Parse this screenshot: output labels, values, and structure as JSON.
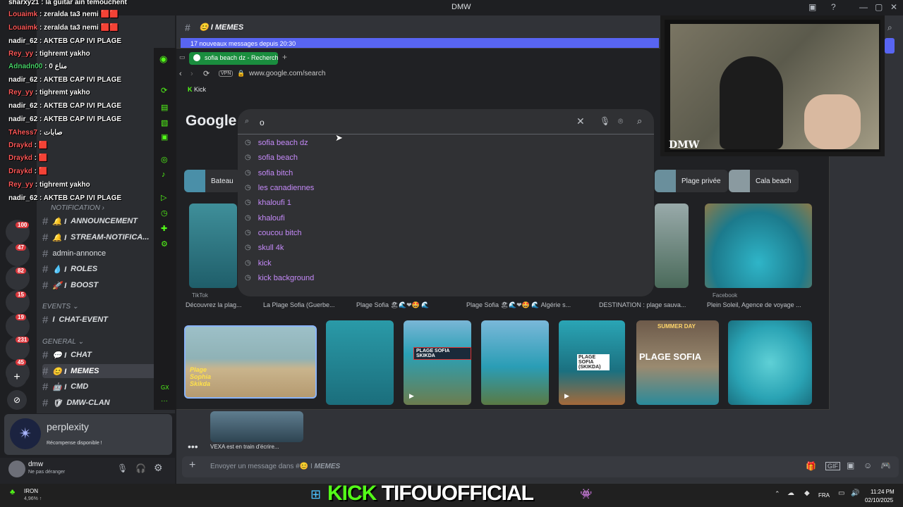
{
  "window": {
    "title": "DMW"
  },
  "overlay_chat": [
    {
      "user": "sharxy21",
      "msg": "la guitar ain temouchent"
    },
    {
      "user": "Louaimk",
      "msg": "zeralda ta3 nemi"
    },
    {
      "user": "Louaimk",
      "msg": "zeralda ta3 nemi"
    },
    {
      "user": "nadir_62",
      "msg": "AKTEB CAP IVI PLAGE"
    },
    {
      "user": "Rey_yy",
      "msg": "tighremt yakho"
    },
    {
      "user": "Adnadn00",
      "msg": "0 مناع"
    },
    {
      "user": "nadir_62",
      "msg": "AKTEB CAP IVI PLAGE"
    },
    {
      "user": "Rey_yy",
      "msg": "tighremt yakho"
    },
    {
      "user": "nadir_62",
      "msg": "AKTEB CAP IVI PLAGE"
    },
    {
      "user": "nadir_62",
      "msg": "AKTEB CAP IVI PLAGE"
    },
    {
      "user": "TAhess7",
      "msg": "صابات"
    },
    {
      "user": "Draykd",
      "msg": ""
    },
    {
      "user": "Draykd",
      "msg": ""
    },
    {
      "user": "Draykd",
      "msg": ""
    },
    {
      "user": "Rey_yy",
      "msg": "tighremt yakho"
    },
    {
      "user": "nadir_62",
      "msg": "AKTEB CAP IVI PLAGE"
    }
  ],
  "channels": {
    "categories": {
      "events": "EVENTS",
      "general": "GENERAL",
      "notification": "NOTIFICATION"
    },
    "items": [
      {
        "label": "ANNOUNCEMENT"
      },
      {
        "label": "STREAM-NOTIFICA..."
      },
      {
        "label": "admin-annonce"
      },
      {
        "label": "ROLES"
      },
      {
        "label": "BOOST"
      },
      {
        "label": "CHAT-EVENT"
      },
      {
        "label": "CHAT"
      },
      {
        "label": "MEMES"
      },
      {
        "label": "CMD"
      },
      {
        "label": "DMW-CLAN"
      }
    ],
    "badges": [
      "100",
      "47",
      "82",
      "15",
      "19",
      "231",
      "45"
    ]
  },
  "chat": {
    "header": "MEMES",
    "new_messages": "17 nouveaux messages depuis 20:30",
    "composer_placeholder": "Envoyer un message dans #",
    "composer_channel": "MEMES",
    "typing": "VEXA est en train d'écrire..."
  },
  "promo": {
    "title": "perplexity",
    "subtitle": "Récompense disponible !"
  },
  "user": {
    "name": "dmw",
    "status": "Ne pas déranger"
  },
  "browser": {
    "tab_label": "sofia beach dz - Recherch",
    "url": "www.google.com/search",
    "vpn": "VPN",
    "bookmark": "Kick",
    "logo": "Google",
    "query": "o",
    "suggestions": [
      "sofia beach dz",
      "sofia beach",
      "sofia bitch",
      "les canadiennes",
      "khaloufi 1",
      "khaloufi",
      "coucou bitch",
      "skull 4k",
      "kick",
      "kick background"
    ],
    "chips": [
      "Bateau",
      "Plage privée",
      "Cala beach"
    ],
    "captions": [
      "Découvrez la plag...",
      "La Plage Sofia (Guerbe...",
      "Plage Sofia",
      "Plage Sofia",
      "DESTINATION : plage sauva...",
      "Plein Soleil, Agence de voyage ..."
    ],
    "sources": [
      "TikTok",
      "Facebook"
    ],
    "image_labels": [
      "PLAGE SOFIA SKIKDA",
      "PLAGE SOFIA (SKIKDA)",
      "SUMMER DAY",
      "PLAGE SOFIA",
      "Plage Sophia Skikda"
    ]
  },
  "webcam": {
    "logo": "DMW"
  },
  "stream_banner": {
    "kick": "KICK",
    "name": "TIFOUOFFICIAL"
  },
  "taskbar": {
    "weather_temp": "IRON",
    "weather_sub": "4,96% ↑",
    "lang": "FRA",
    "time": "11:24 PM",
    "date": "02/10/2025"
  },
  "colors": {
    "kick_green": "#53fc18",
    "discord_blurple": "#5865f2",
    "suggestion_purple": "#c58af9"
  }
}
